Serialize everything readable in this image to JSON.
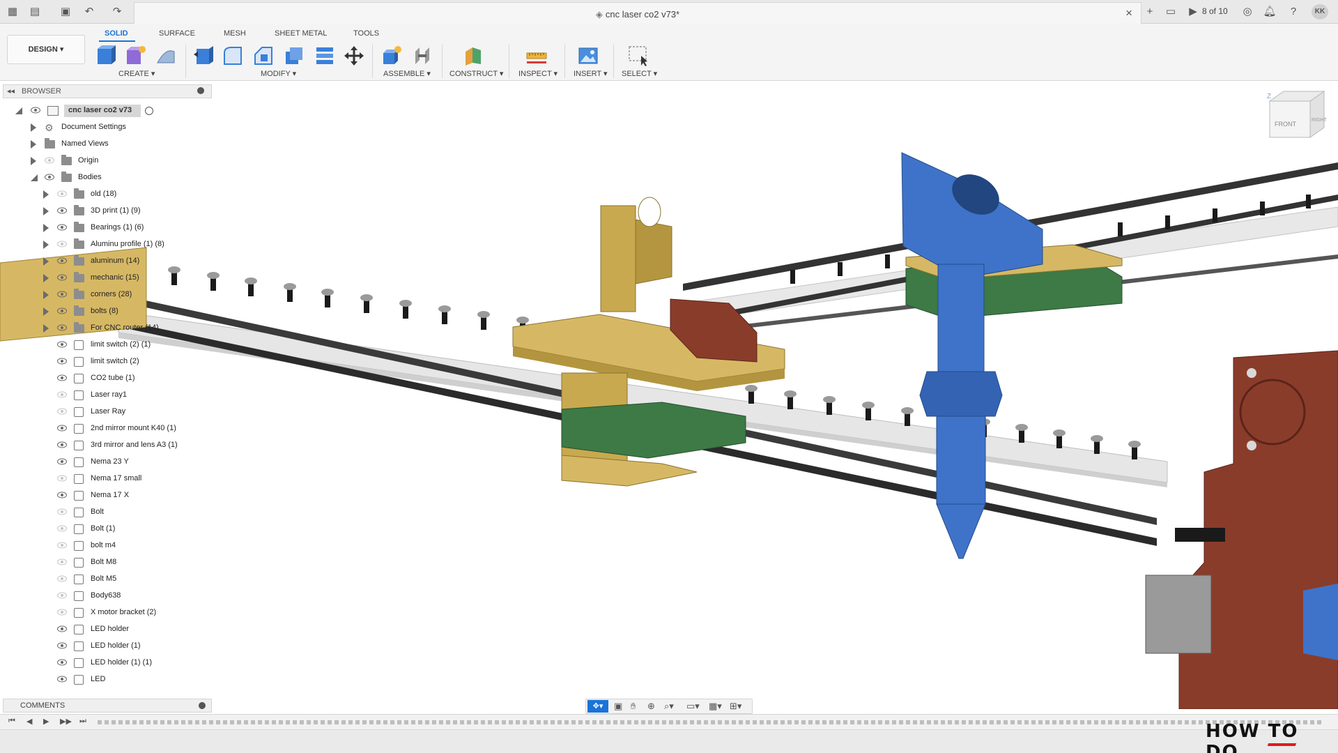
{
  "app": {
    "document_title": "cnc laser co2 v73*",
    "counter": "8 of 10",
    "user_initials": "KK"
  },
  "toolbar": {
    "workspace": "DESIGN ▾",
    "tabs": [
      "SOLID",
      "SURFACE",
      "MESH",
      "SHEET METAL",
      "TOOLS"
    ],
    "groups": {
      "create": "CREATE ▾",
      "modify": "MODIFY ▾",
      "assemble": "ASSEMBLE ▾",
      "construct": "CONSTRUCT ▾",
      "inspect": "INSPECT ▾",
      "insert": "INSERT ▾",
      "select": "SELECT ▾"
    }
  },
  "browser": {
    "title": "BROWSER",
    "root": "cnc laser co2 v73",
    "items": [
      "Document Settings",
      "Named Views",
      "Origin",
      "Bodies",
      "old (18)",
      "3D print (1) (9)",
      "Bearings (1) (6)",
      "Aluminu profile (1) (8)",
      "aluminum (14)",
      "mechanic (15)",
      "corners (28)",
      "bolts (8)",
      "For CNC router (14)",
      "limit switch (2) (1)",
      "limit switch (2)",
      "CO2 tube (1)",
      "Laser ray1",
      "Laser Ray",
      "2nd mirror mount K40 (1)",
      "3rd mirror and lens A3 (1)",
      "Nema 23 Y",
      "Nema 17 small",
      "Nema 17 X",
      "Bolt",
      "Bolt (1)",
      "bolt m4",
      "Bolt M8",
      "Bolt M5",
      "Body638",
      "X motor bracket (2)",
      "LED holder",
      "LED holder (1)",
      "LED holder (1) (1)",
      "LED"
    ]
  },
  "comments": {
    "label": "COMMENTS"
  },
  "viewcube": {
    "front": "FRONT",
    "right": "RIGHT",
    "axis": "Z"
  },
  "watermark": {
    "text": "HOW TO DO"
  },
  "colors": {
    "accent": "#1a73d8",
    "nozzle": "#3f73c9",
    "wood": "#c9a94f",
    "pcb": "#3d7a45",
    "motor": "#8a3c2a"
  }
}
